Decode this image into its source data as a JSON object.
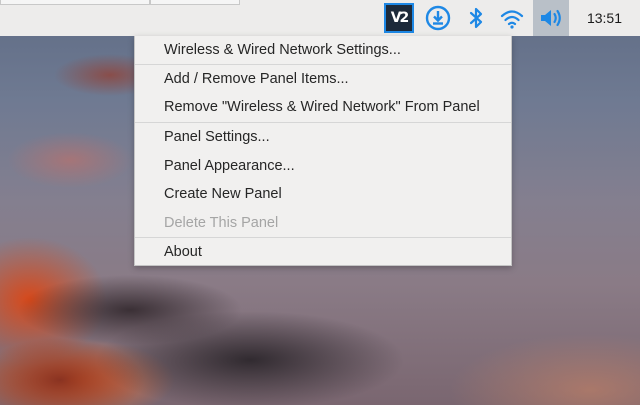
{
  "panel": {
    "clock": "13:51",
    "tray": {
      "vnc_label": "V2",
      "icons": [
        "vnc-icon",
        "download-icon",
        "bluetooth-icon",
        "wifi-icon",
        "volume-icon"
      ]
    }
  },
  "context_menu": {
    "items": [
      {
        "label": "Wireless & Wired Network Settings...",
        "enabled": true
      },
      {
        "label": "Add / Remove Panel Items...",
        "enabled": true
      },
      {
        "label": "Remove \"Wireless & Wired Network\" From Panel",
        "enabled": true
      },
      {
        "label": "Panel Settings...",
        "enabled": true
      },
      {
        "label": "Panel Appearance...",
        "enabled": true
      },
      {
        "label": "Create New Panel",
        "enabled": true
      },
      {
        "label": "Delete This Panel",
        "enabled": false
      },
      {
        "label": "About",
        "enabled": true
      }
    ]
  },
  "colors": {
    "accent": "#1e88e5",
    "panel_bg": "#edeceb",
    "menu_bg": "#f1f0ef",
    "disabled_text": "#a5a5a5"
  }
}
